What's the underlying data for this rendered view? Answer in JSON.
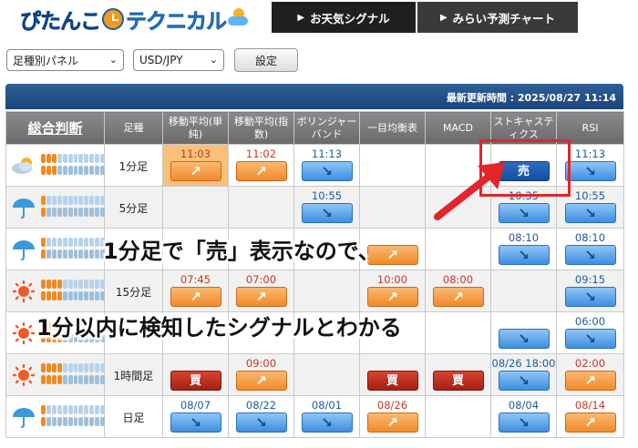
{
  "header": {
    "logo_part1": "ぴたんこ",
    "logo_part2": "テクニカル",
    "tabs": [
      {
        "label": "お天気シグナル",
        "arrow": "▶"
      },
      {
        "label": "みらい予測チャート",
        "arrow": "▶"
      }
    ]
  },
  "controls": {
    "panel_select": "足種別パネル",
    "pair_select": "USD/JPY",
    "set_button": "設定"
  },
  "update": {
    "label": "最新更新時間 : 2025/08/27 11:14"
  },
  "table": {
    "headers": [
      "総合判断",
      "足種",
      "移動平均(単純)",
      "移動平均(指数)",
      "ボリンジャーバンド",
      "一目均衡表",
      "MACD",
      "ストキャスティクス",
      "RSI"
    ],
    "rows": [
      {
        "weather": "cloudy",
        "bars": 3,
        "timeframe": "1分足",
        "cells": [
          {
            "time": "11:03",
            "signal": "up",
            "hl": true
          },
          {
            "time": "11:02",
            "signal": "up"
          },
          {
            "time": "11:13",
            "signal": "down",
            "blue": true
          },
          {
            "time": "",
            "signal": ""
          },
          {
            "time": "",
            "signal": ""
          },
          {
            "time": "",
            "signal": "sell",
            "label": "売"
          },
          {
            "time": "11:13",
            "signal": "down",
            "blue": true
          }
        ]
      },
      {
        "weather": "umbrella",
        "bars": 1,
        "timeframe": "5分足",
        "cells": [
          {
            "time": "",
            "signal": ""
          },
          {
            "time": "",
            "signal": ""
          },
          {
            "time": "10:55",
            "signal": "down",
            "blue": true
          },
          {
            "time": "",
            "signal": ""
          },
          {
            "time": "",
            "signal": ""
          },
          {
            "time": "10:35",
            "signal": "down",
            "blue": true
          },
          {
            "time": "10:55",
            "signal": "down",
            "blue": true
          }
        ]
      },
      {
        "weather": "umbrella",
        "bars": 1,
        "timeframe": "",
        "cells": [
          {
            "time": "",
            "signal": ""
          },
          {
            "time": "",
            "signal": ""
          },
          {
            "time": "",
            "signal": ""
          },
          {
            "time": "",
            "signal": "up"
          },
          {
            "time": "",
            "signal": ""
          },
          {
            "time": "08:10",
            "signal": "down",
            "blue": true
          },
          {
            "time": "08:10",
            "signal": "down",
            "blue": true
          }
        ]
      },
      {
        "weather": "sun",
        "bars": 4,
        "timeframe": "15分足",
        "cells": [
          {
            "time": "07:45",
            "signal": "up"
          },
          {
            "time": "07:00",
            "signal": "up"
          },
          {
            "time": "",
            "signal": ""
          },
          {
            "time": "10:00",
            "signal": "up"
          },
          {
            "time": "08:00",
            "signal": "up"
          },
          {
            "time": "",
            "signal": ""
          },
          {
            "time": "09:15",
            "signal": "down",
            "blue": true
          }
        ]
      },
      {
        "weather": "sun",
        "bars": 4,
        "timeframe": "",
        "cells": [
          {
            "time": "",
            "signal": ""
          },
          {
            "time": "",
            "signal": ""
          },
          {
            "time": "",
            "signal": ""
          },
          {
            "time": "",
            "signal": ""
          },
          {
            "time": "",
            "signal": ""
          },
          {
            "time": "",
            "signal": "down"
          },
          {
            "time": "06:00",
            "signal": "down",
            "blue": true
          }
        ]
      },
      {
        "weather": "sun",
        "bars": 4,
        "timeframe": "1時間足",
        "cells": [
          {
            "time": "",
            "signal": "buy",
            "label": "買"
          },
          {
            "time": "09:00",
            "signal": "up"
          },
          {
            "time": "",
            "signal": ""
          },
          {
            "time": "",
            "signal": "buy",
            "label": "買"
          },
          {
            "time": "",
            "signal": "buy",
            "label": "買"
          },
          {
            "time": "08/26 18:00",
            "signal": "down",
            "blue": true
          },
          {
            "time": "02:00",
            "signal": "up"
          }
        ]
      },
      {
        "weather": "umbrella",
        "bars": 1,
        "timeframe": "日足",
        "cells": [
          {
            "time": "08/07",
            "signal": "down",
            "blue": true
          },
          {
            "time": "08/22",
            "signal": "down",
            "blue": true
          },
          {
            "time": "08/01",
            "signal": "down",
            "blue": true
          },
          {
            "time": "08/26",
            "signal": "up"
          },
          {
            "time": "",
            "signal": ""
          },
          {
            "time": "08/04",
            "signal": "down",
            "blue": true
          },
          {
            "time": "08/14",
            "signal": "up"
          }
        ]
      }
    ]
  },
  "annotation": {
    "line1": "1分足で「売」表示なので、",
    "line2": "1分以内に検知したシグナルとわかる"
  },
  "colors": {
    "up": "#f08a2b",
    "down": "#3e8ee0",
    "buy": "#b8271a",
    "sell": "#1a52a6",
    "annotation": "#e2242b"
  }
}
